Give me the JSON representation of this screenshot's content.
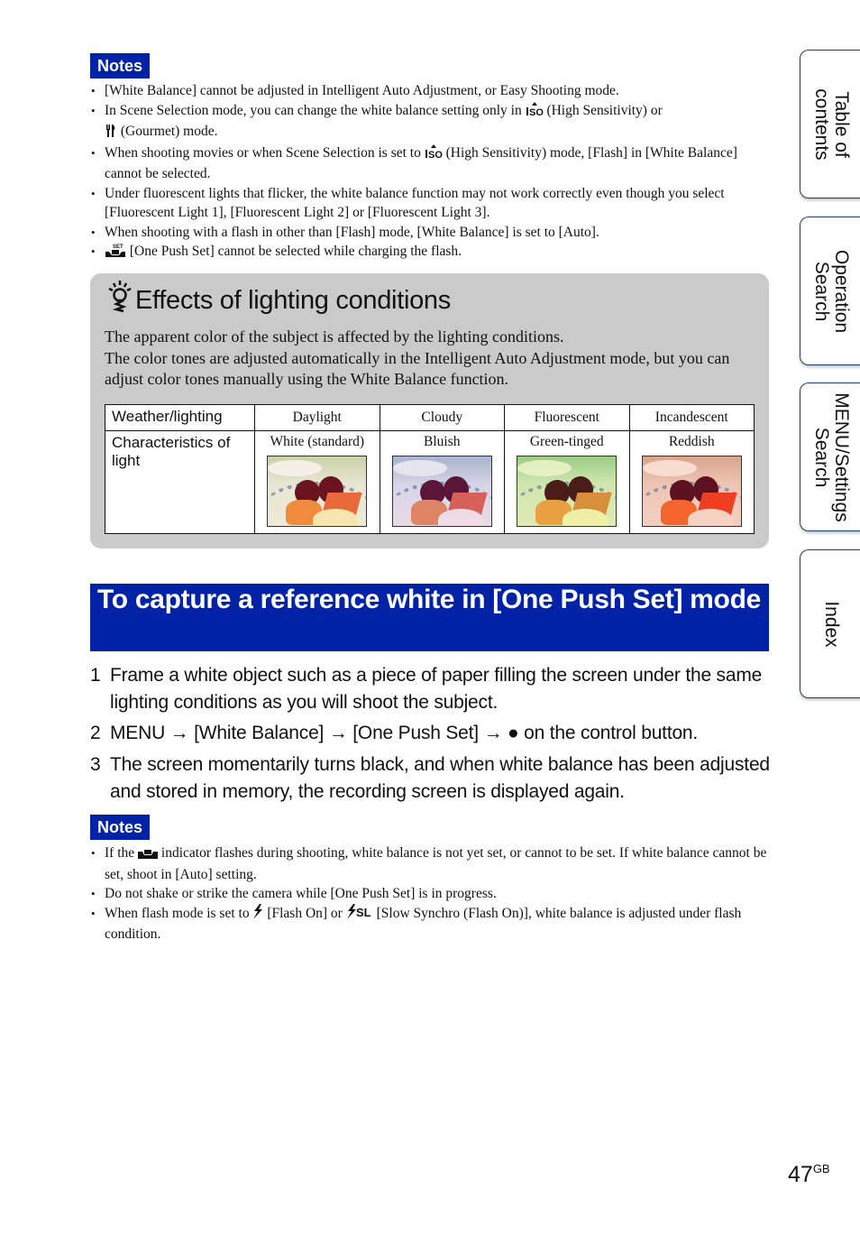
{
  "notes_top": {
    "badge": "Notes",
    "items": [
      {
        "text": "[White Balance] cannot be adjusted in Intelligent Auto Adjustment, or Easy Shooting mode."
      },
      {
        "pre": "In Scene Selection mode, you can change the white balance setting only in ",
        "icon1": "high-sensitivity-icon",
        "mid": " (High Sensitivity) or ",
        "icon2": "gourmet-icon",
        "post": " (Gourmet) mode."
      },
      {
        "pre": "When shooting movies or when Scene Selection is set to ",
        "icon1": "high-sensitivity-icon",
        "post": " (High Sensitivity) mode, [Flash] in [White Balance] cannot be selected."
      },
      {
        "text": "Under fluorescent lights that flicker, the white balance function may not work correctly even though you select [Fluorescent Light 1], [Fluorescent Light 2] or [Fluorescent Light 3]."
      },
      {
        "text": "When shooting with a flash in other than [Flash] mode, [White Balance] is set to [Auto]."
      },
      {
        "icon1": "one-push-set-icon",
        "post": " [One Push Set] cannot be selected while charging the flash."
      }
    ]
  },
  "tip": {
    "icon": "lightbulb-icon",
    "title": "Effects of lighting conditions",
    "para1": "The apparent color of the subject is affected by the lighting conditions.",
    "para2": "The color tones are adjusted automatically in the Intelligent Auto Adjustment mode, but you can adjust color tones manually using the White Balance function.",
    "table": {
      "row_labels": [
        "Weather/lighting",
        "Characteristics of light"
      ],
      "columns": [
        {
          "lighting": "Daylight",
          "characteristic": "White (standard)",
          "tint": "neutral"
        },
        {
          "lighting": "Cloudy",
          "characteristic": "Bluish",
          "tint": "blue"
        },
        {
          "lighting": "Fluorescent",
          "characteristic": "Green-tinged",
          "tint": "green"
        },
        {
          "lighting": "Incandescent",
          "characteristic": "Reddish",
          "tint": "red"
        }
      ]
    }
  },
  "section": {
    "title": "To capture a reference white in [One Push Set] mode"
  },
  "steps": [
    {
      "num": "1",
      "text": "Frame a white object such as a piece of paper filling the screen under the same lighting conditions as you will shoot the subject."
    },
    {
      "num": "2",
      "parts": [
        "MENU",
        "[White Balance]",
        "[One Push Set]",
        "on the control button."
      ],
      "arrow": "→",
      "bullet": "●"
    },
    {
      "num": "3",
      "text": "The screen momentarily turns black, and when white balance has been adjusted and stored in memory, the recording screen is displayed again."
    }
  ],
  "notes_bottom": {
    "badge": "Notes",
    "items": [
      {
        "pre": "If the ",
        "icon1": "one-push-indicator-icon",
        "post": " indicator flashes during shooting, white balance is not yet set, or cannot to be set. If white balance cannot be set, shoot in [Auto] setting."
      },
      {
        "text": "Do not shake or strike the camera while [One Push Set] is in progress."
      },
      {
        "pre": "When flash mode is set to ",
        "icon1": "flash-on-icon",
        "mid": " [Flash On] or ",
        "icon2": "slow-synchro-icon",
        "icon2_text": "SL",
        "post": " [Slow Synchro (Flash On)], white balance is adjusted under flash condition."
      }
    ]
  },
  "side_tabs": [
    {
      "label": "Table of contents"
    },
    {
      "label": "Operation Search"
    },
    {
      "label": "MENU/Settings Search"
    },
    {
      "label": "Index"
    }
  ],
  "page": {
    "number": "47",
    "suffix": "GB"
  },
  "colors": {
    "accent_blue": "#0022a6",
    "tip_gray": "#cacaca",
    "tab_border": "#1a3f70"
  }
}
